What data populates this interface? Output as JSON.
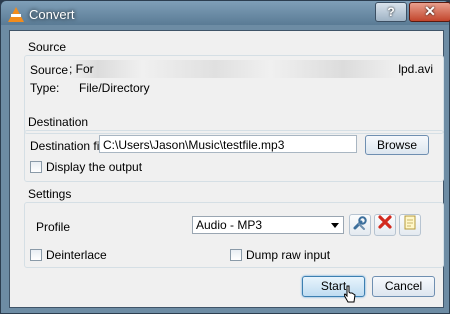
{
  "window": {
    "title": "Convert",
    "help_label": "?",
    "close_label": "✕"
  },
  "source": {
    "group_title": "Source",
    "source_label": "Source:",
    "source_value_start": "; For",
    "source_value_end": "lpd.avi",
    "type_label": "Type:",
    "type_value": "File/Directory"
  },
  "destination": {
    "group_title": "Destination",
    "file_label": "Destination file:",
    "file_value": "C:\\Users\\Jason\\Music\\testfile.mp3",
    "browse_label": "Browse",
    "display_output_label": "Display the output"
  },
  "settings": {
    "group_title": "Settings",
    "profile_label": "Profile",
    "profile_value": "Audio - MP3",
    "deinterlace_label": "Deinterlace",
    "dump_raw_label": "Dump raw input"
  },
  "buttons": {
    "start_label": "Start",
    "cancel_label": "Cancel"
  },
  "icons": {
    "edit_profile": "wrench-icon",
    "delete_profile": "delete-x-icon",
    "new_profile": "new-profile-icon"
  },
  "colors": {
    "delete_red": "#d22a1e",
    "accent_blue": "#3c7fb1",
    "vlc_orange": "#f28c1c"
  }
}
